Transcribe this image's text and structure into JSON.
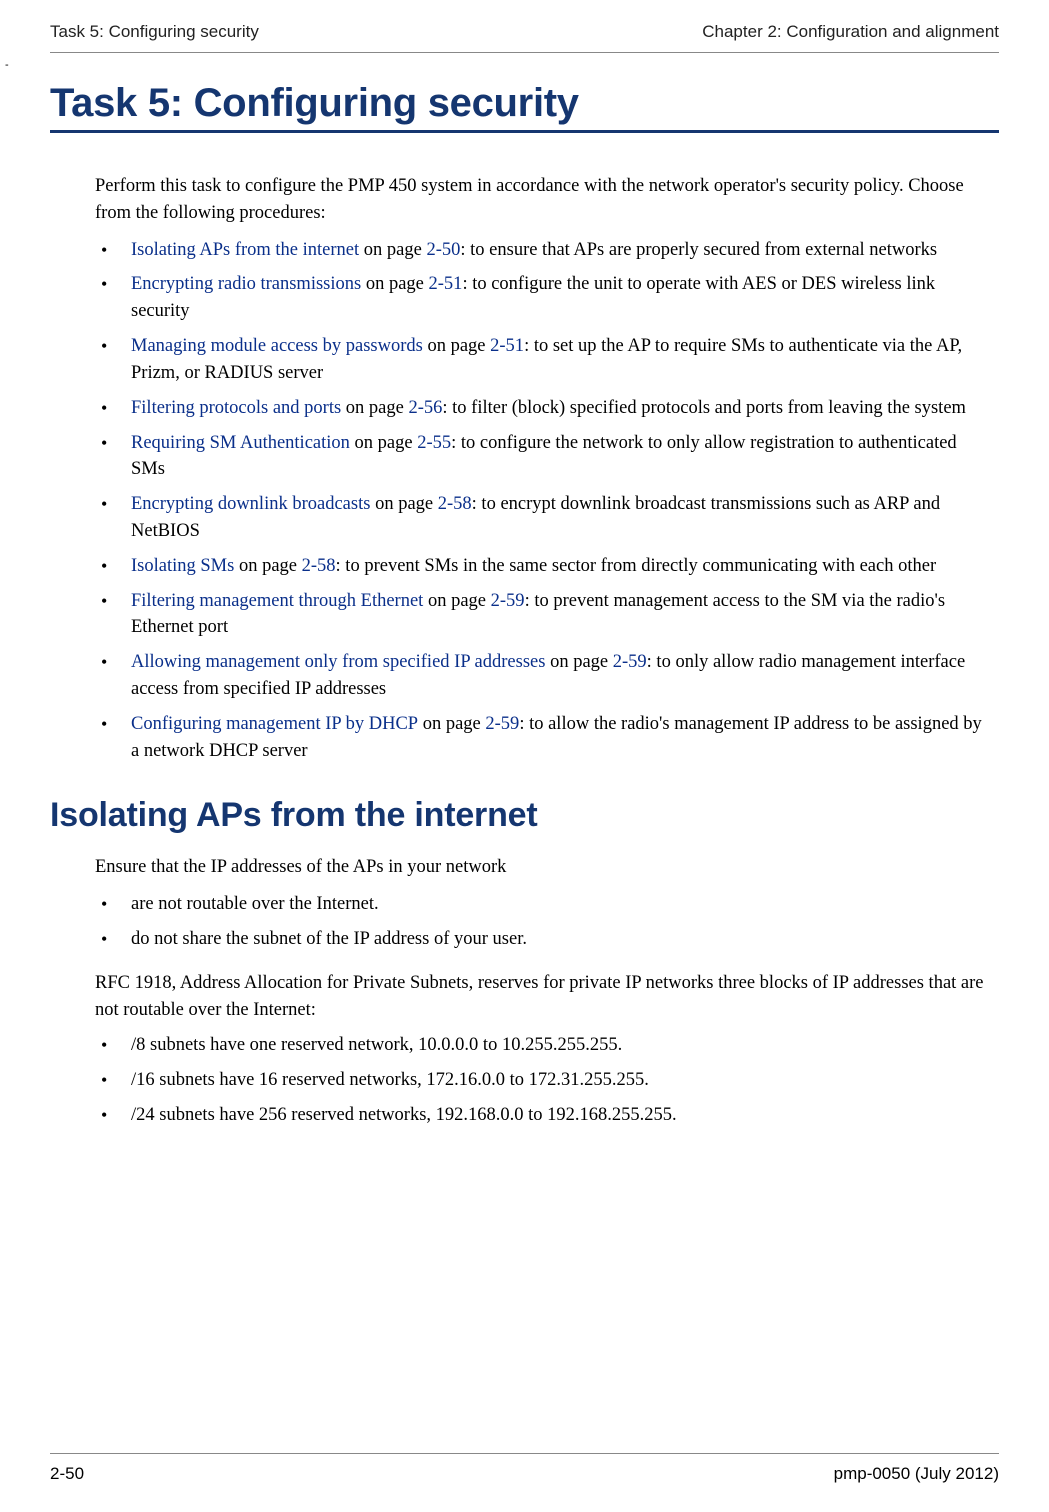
{
  "header": {
    "left": "Task 5: Configuring security",
    "right": "Chapter 2:  Configuration and alignment"
  },
  "stray": "-",
  "title": "Task 5: Configuring security",
  "intro": "Perform this task to configure the PMP 450 system in accordance with the network operator's security policy. Choose from the following procedures:",
  "procedures": [
    {
      "link": "Isolating APs from the internet",
      "mid": " on page ",
      "page": "2-50",
      "after": ": to ensure that APs are properly secured from external networks"
    },
    {
      "link": "Encrypting radio transmissions",
      "mid": " on page ",
      "page": "2-51",
      "after": ": to configure the unit to operate with AES or DES wireless link security"
    },
    {
      "link": "Managing module access by passwords",
      "mid": " on page ",
      "page": "2-51",
      "after": ": to set up the AP to require SMs to authenticate via the AP, Prizm, or RADIUS server"
    },
    {
      "link": "Filtering protocols and ports",
      "mid": " on page ",
      "page": "2-56",
      "after": ":  to filter (block) specified protocols and ports from leaving the system"
    },
    {
      "link": "Requiring SM Authentication",
      "mid": " on page ",
      "page": "2-55",
      "after": ": to configure the network to only allow registration to authenticated SMs"
    },
    {
      "link": "Encrypting downlink broadcasts",
      "mid": " on page ",
      "page": "2-58",
      "after": ": to encrypt downlink broadcast transmissions such as ARP and NetBIOS"
    },
    {
      "link": "Isolating SMs",
      "mid": " on page ",
      "page": "2-58",
      "after": ":  to prevent SMs in the same sector from directly communicating with each other"
    },
    {
      "link": "Filtering management through Ethernet",
      "mid": " on page ",
      "page": "2-59",
      "after": ":  to prevent management access to the SM via the radio's Ethernet port"
    },
    {
      "link": "Allowing management only from specified IP addresses",
      "mid": " on page ",
      "page": "2-59",
      "after": ":  to only allow radio management interface access from specified IP addresses"
    },
    {
      "link": "Configuring management IP by DHCP",
      "mid": " on page ",
      "page": "2-59",
      "after": ":  to allow the radio's management IP address to be assigned by a network DHCP server"
    }
  ],
  "section": {
    "title": "Isolating APs from the internet",
    "lead": "Ensure that the IP addresses of the APs in your network",
    "bullets1": [
      "are not routable over the Internet.",
      "do not share the subnet of the IP address of your user."
    ],
    "para": "RFC 1918, Address Allocation for Private Subnets, reserves for private IP networks three blocks of IP addresses that are not routable over the Internet:",
    "bullets2": [
      "/8 subnets have one reserved network, 10.0.0.0 to 10.255.255.255.",
      "/16 subnets have 16 reserved networks, 172.16.0.0 to 172.31.255.255.",
      "/24 subnets have 256 reserved networks, 192.168.0.0 to 192.168.255.255."
    ]
  },
  "footer": {
    "left": "2-50",
    "right": "pmp-0050 (July 2012)"
  }
}
